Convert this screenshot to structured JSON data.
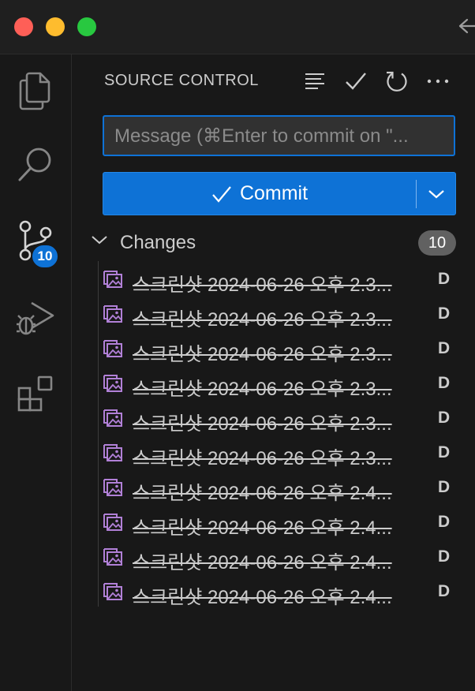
{
  "window": {
    "traffic_colors": {
      "close": "#fe5f57",
      "minimize": "#febc2e",
      "zoom": "#28c840"
    }
  },
  "activity_bar": {
    "items": [
      {
        "name": "explorer",
        "icon": "files-icon"
      },
      {
        "name": "search",
        "icon": "search-icon"
      },
      {
        "name": "source-control",
        "icon": "source-control-icon",
        "badge": "10"
      },
      {
        "name": "run-and-debug",
        "icon": "run-debug-icon"
      },
      {
        "name": "extensions",
        "icon": "extensions-icon"
      }
    ]
  },
  "source_control": {
    "title": "SOURCE CONTROL",
    "toolbar_icons": [
      "view-as-tree-icon",
      "check-icon",
      "refresh-icon",
      "more-icon"
    ],
    "message": {
      "value": "",
      "placeholder": "Message (⌘Enter to commit on \"..."
    },
    "commit": {
      "label": "Commit",
      "icon": "check-icon",
      "dropdown_icon": "chevron-down-icon",
      "color": "#0e72d6"
    },
    "changes": {
      "label": "Changes",
      "count": "10",
      "files": [
        {
          "name": "스크린샷 2024-06-26 오후 2.3...",
          "status": "D"
        },
        {
          "name": "스크린샷 2024-06-26 오후 2.3...",
          "status": "D"
        },
        {
          "name": "스크린샷 2024-06-26 오후 2.3...",
          "status": "D"
        },
        {
          "name": "스크린샷 2024-06-26 오후 2.3...",
          "status": "D"
        },
        {
          "name": "스크린샷 2024-06-26 오후 2.3...",
          "status": "D"
        },
        {
          "name": "스크린샷 2024-06-26 오후 2.3...",
          "status": "D"
        },
        {
          "name": "스크린샷 2024-06-26 오후 2.4...",
          "status": "D"
        },
        {
          "name": "스크린샷 2024-06-26 오후 2.4...",
          "status": "D"
        },
        {
          "name": "스크린샷 2024-06-26 오후 2.4...",
          "status": "D"
        },
        {
          "name": "스크린샷 2024-06-26 오후 2.4...",
          "status": "D"
        }
      ]
    }
  }
}
